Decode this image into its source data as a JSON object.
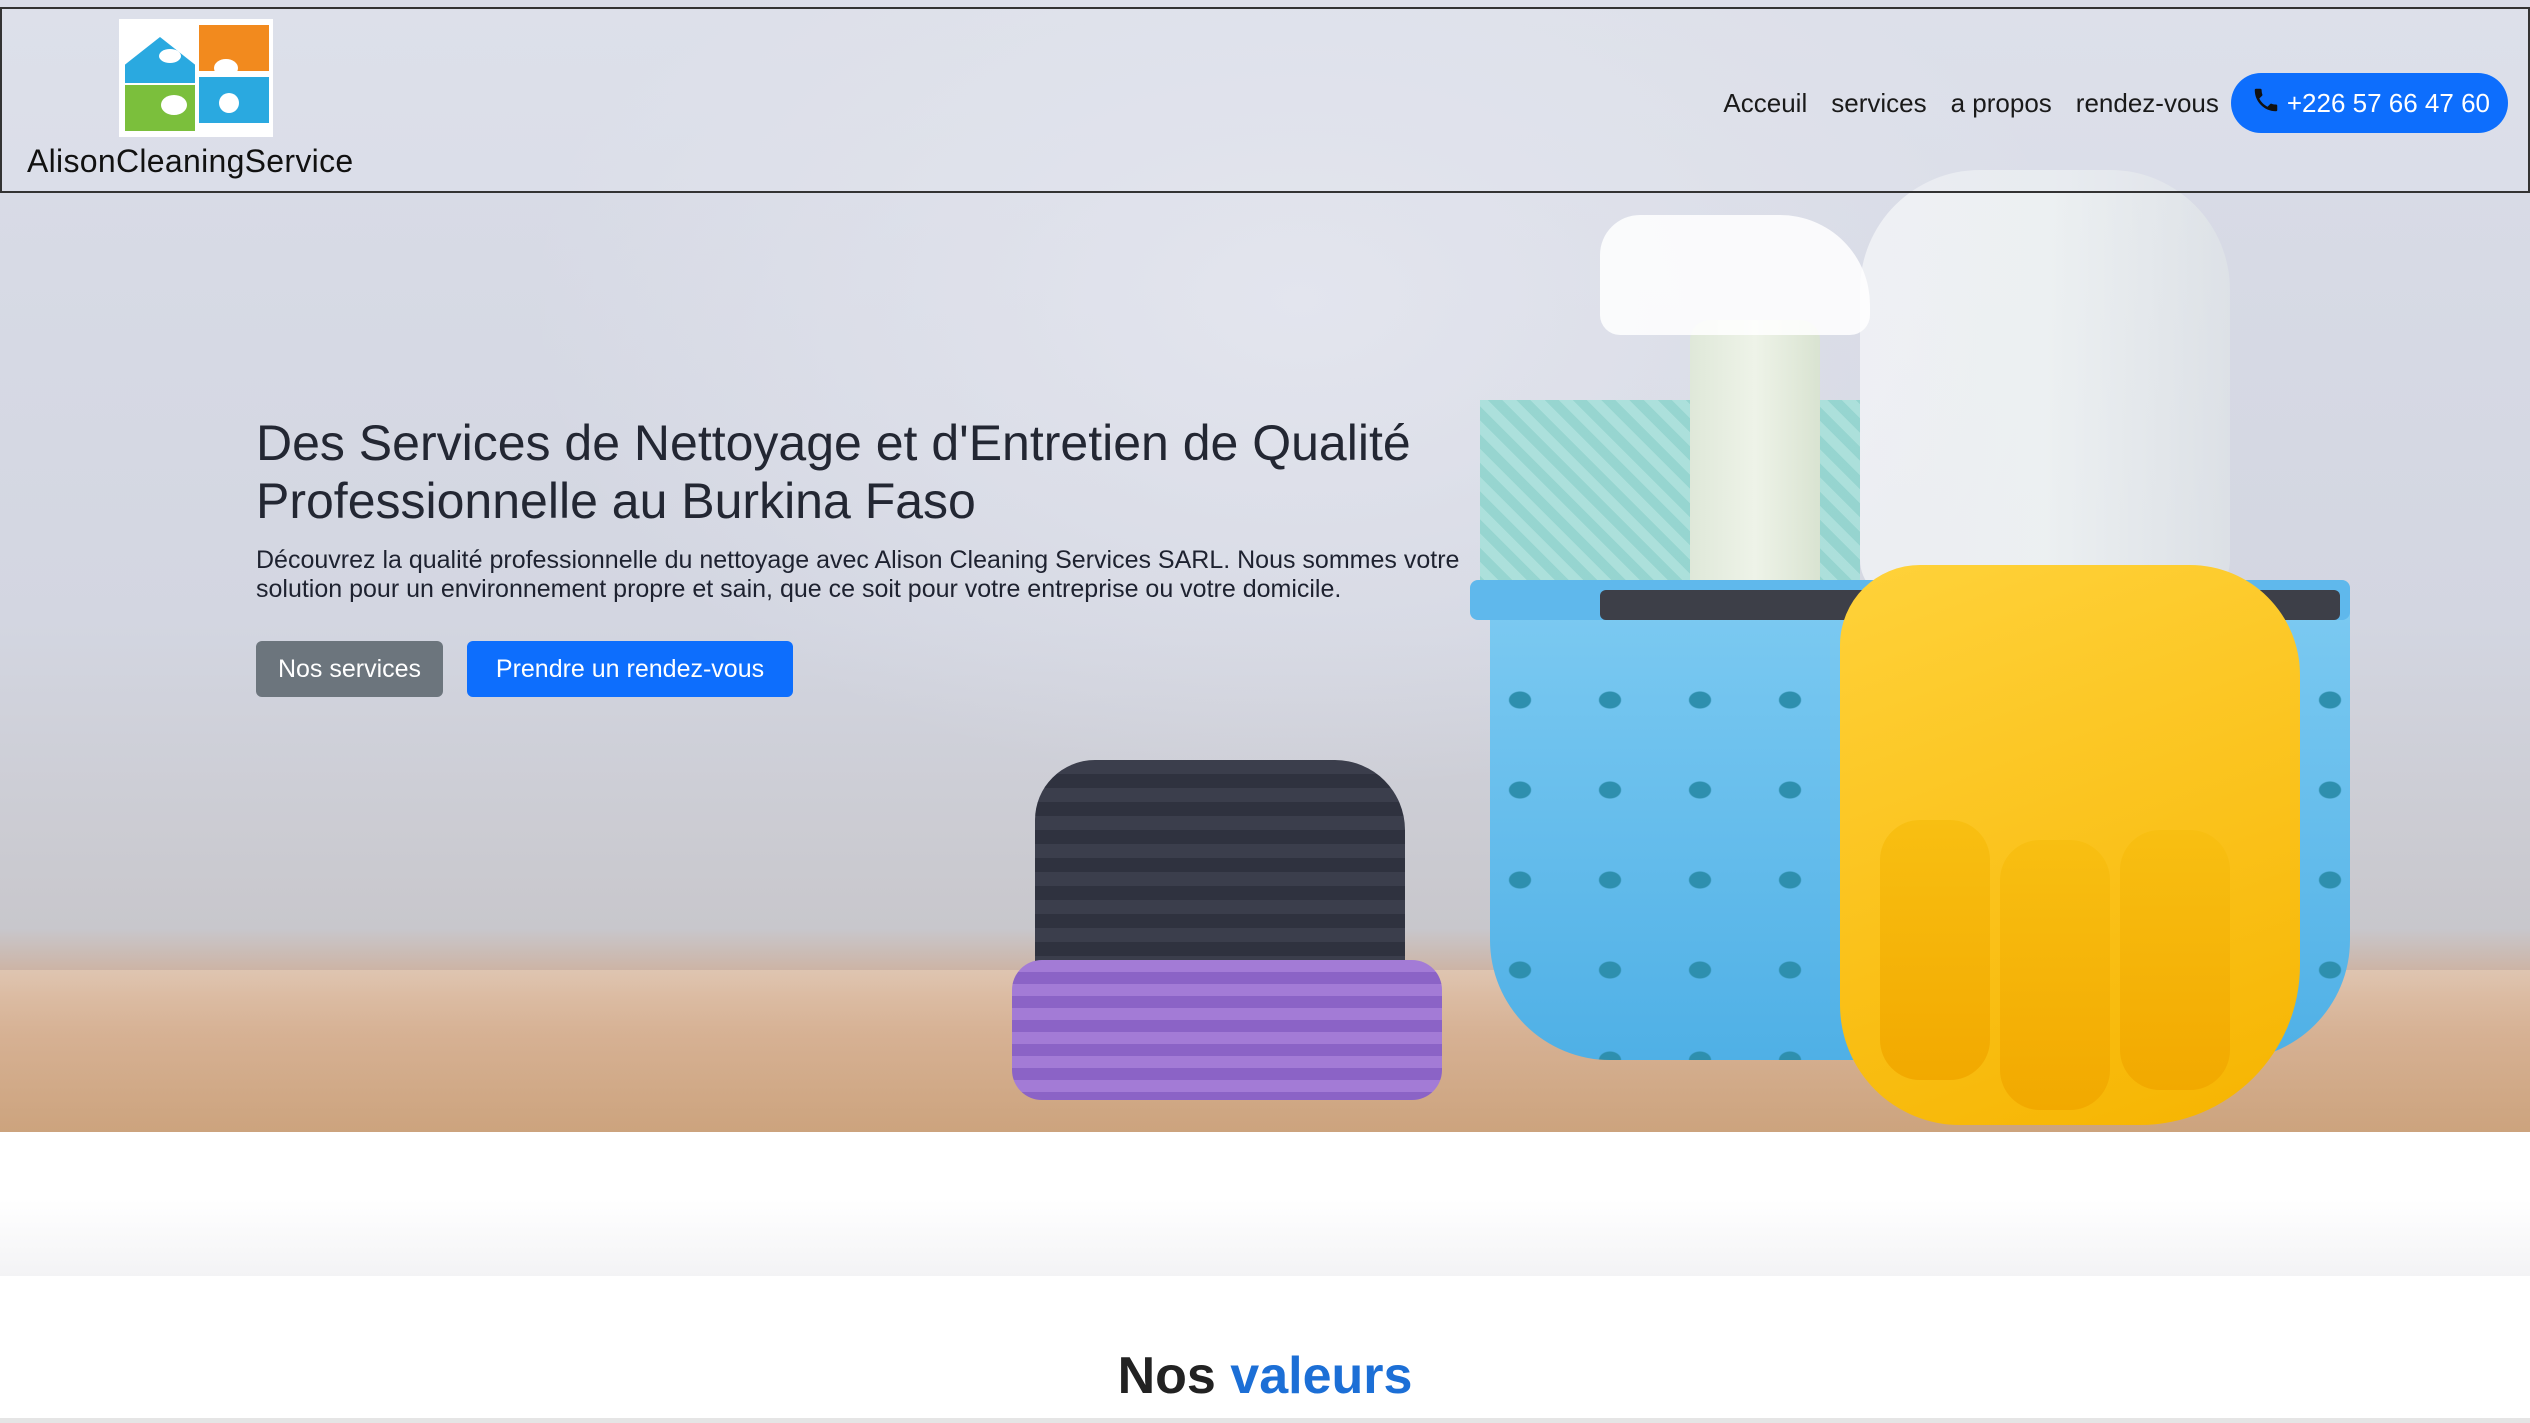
{
  "header": {
    "brand": "AlisonCleaningService",
    "nav": [
      {
        "label": "Acceuil"
      },
      {
        "label": "services"
      },
      {
        "label": "a propos"
      },
      {
        "label": "rendez-vous"
      }
    ],
    "phone": "+226 57 66 47 60"
  },
  "hero": {
    "title_line1": "Des Services de Nettoyage et d'Entretien de Qualité",
    "title_line2": "Professionnelle au Burkina Faso",
    "description_line1": "Découvrez la qualité professionnelle du nettoyage avec Alison Cleaning Services SARL. Nous sommes votre",
    "description_line2": "solution pour un environnement propre et sain, que ce soit pour votre entreprise ou votre domicile.",
    "btn_services": "Nos services",
    "btn_rdv": "Prendre un rendez-vous"
  },
  "values": {
    "title_prefix": "Nos",
    "title_accent": "valeurs"
  },
  "colors": {
    "primary": "#0d6efd",
    "secondary": "#6c757d",
    "accent": "#1c6fd6"
  }
}
